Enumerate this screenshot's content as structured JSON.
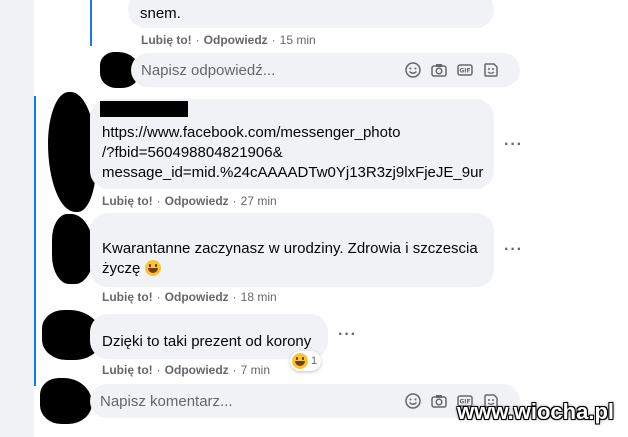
{
  "comments": [
    {
      "text": "snem.",
      "like_label": "Lubię to!",
      "reply_label": "Odpowiedz",
      "time": "15 min"
    },
    {
      "text_lines": [
        "https://www.facebook.com/messenger_photo",
        "/?fbid=560498804821906&",
        "message_id=mid.%24cAAAADTw0Yj13R3zj9lxFjeJE_9ur"
      ],
      "like_label": "Lubię to!",
      "reply_label": "Odpowiedz",
      "time": "27 min"
    },
    {
      "text_lines": [
        "Kwarantanne zaczynasz w urodziny. Zdrowia i szczescia",
        "życzę"
      ],
      "like_label": "Lubię to!",
      "reply_label": "Odpowiedz",
      "time": "18 min"
    },
    {
      "text": "Dzięki to taki prezent od korony",
      "reaction_count": "1",
      "like_label": "Lubię to!",
      "reply_label": "Odpowiedz",
      "time": "7 min"
    }
  ],
  "reply_input": {
    "placeholder": "Napisz odpowiedź..."
  },
  "comment_input": {
    "placeholder": "Napisz komentarz..."
  },
  "watermark": "www.wiocha.pl",
  "colors": {
    "thread_line": "#1877f2",
    "bubble": "#f0f2f5",
    "meta": "#65676b"
  },
  "input_icons": [
    "emoji-icon",
    "camera-icon",
    "gif-icon",
    "sticker-icon"
  ]
}
